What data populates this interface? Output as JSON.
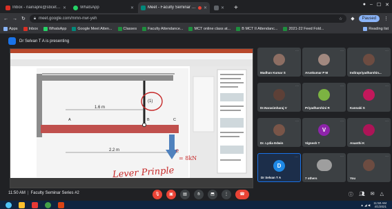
{
  "browser": {
    "tabs": [
      {
        "title": "Inbox - nainapre@sbcet.ac.in - Sa",
        "color": "#d93025",
        "active": false
      },
      {
        "title": "WhatsApp",
        "color": "#25d366",
        "active": false
      },
      {
        "title": "Meet - Faculty Seminar Seri",
        "color": "#00897b",
        "active": true
      },
      {
        "title": "",
        "color": "#3c4043",
        "active": false
      }
    ],
    "url": "meet.google.com/mmn-nwr-yeh",
    "paused_label": "Paused",
    "bookmarks": [
      {
        "label": "Apps",
        "color": "#8ab4f8"
      },
      {
        "label": "Inbox",
        "color": "#d93025"
      },
      {
        "label": "WhatsApp",
        "color": "#25d366"
      },
      {
        "label": "Google Meet Atten...",
        "color": "#00897b"
      },
      {
        "label": "Classes",
        "color": "#1e8e3e"
      },
      {
        "label": "Faculty Attendance...",
        "color": "#1e8e3e"
      },
      {
        "label": "MCT online class at...",
        "color": "#1e8e3e"
      },
      {
        "label": "B MCT II Attendanc...",
        "color": "#1e8e3e"
      },
      {
        "label": "2021-22 Feed Fold...",
        "color": "#1e8e3e"
      }
    ],
    "reading_list": "Reading list"
  },
  "meet": {
    "presenting_text": "Dr Selvan T A is presenting",
    "shared_screen": {
      "dim_top": "1.6 m",
      "dim_bottom": "2.2 m",
      "circle_label": "(1)",
      "point_a": "A",
      "point_b": "B",
      "point_c": "C",
      "force_label": "P",
      "force_value": "= 8kN",
      "annotation": "Lever Prinple"
    },
    "participants": [
      {
        "name": "Madhan Kumar S",
        "kind": "photo",
        "avatar_color": "#8d6e63"
      },
      {
        "name": "Arunkumar P M",
        "kind": "photo",
        "avatar_color": "#a1887f"
      },
      {
        "name": "Indirapriyadharshin...",
        "kind": "photo",
        "avatar_color": "#6d4c41"
      },
      {
        "name": "Dr.Narasimharaj V",
        "kind": "photo",
        "avatar_color": "#5d4037"
      },
      {
        "name": "Priyadharshini R",
        "kind": "photo",
        "avatar_color": "#7cb342"
      },
      {
        "name": "Kannaki S",
        "kind": "photo",
        "avatar_color": "#c2185b"
      },
      {
        "name": "Dr. Lydia Edwin",
        "kind": "photo",
        "avatar_color": "#795548"
      },
      {
        "name": "Vignesh T",
        "kind": "letter",
        "letter": "V",
        "avatar_color": "#8e24aa"
      },
      {
        "name": "Ananthi K",
        "kind": "photo",
        "avatar_color": "#ad1457"
      },
      {
        "name": "Dr Selvan T A",
        "kind": "letter",
        "letter": "D",
        "avatar_color": "#1e88e5"
      },
      {
        "name": "7 others",
        "kind": "group",
        "avatar_color": "#9e9e9e"
      },
      {
        "name": "You",
        "kind": "photo",
        "avatar_color": "#6d4c41"
      }
    ],
    "time": "11:50 AM",
    "meeting_title": "Faculty Seminar Series #2"
  },
  "taskbar": {
    "clock_time": "11:50 AM",
    "clock_date": "4/1/2021"
  }
}
